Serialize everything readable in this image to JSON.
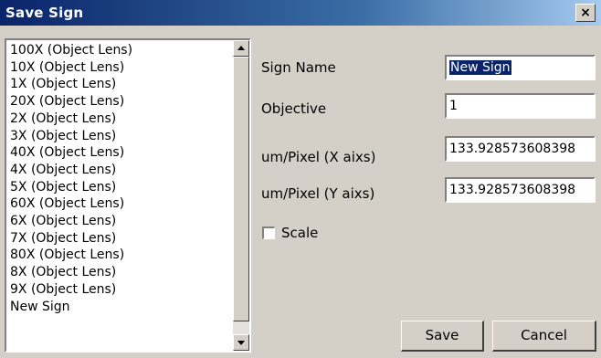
{
  "window": {
    "title": "Save Sign",
    "close_label": "×"
  },
  "list": {
    "items": [
      "100X (Object Lens)",
      "10X (Object Lens)",
      "1X (Object Lens)",
      "20X (Object Lens)",
      "2X (Object Lens)",
      "3X (Object Lens)",
      "40X (Object Lens)",
      "4X (Object Lens)",
      "5X (Object Lens)",
      "60X (Object Lens)",
      "6X (Object Lens)",
      "7X (Object Lens)",
      "80X (Object Lens)",
      "8X (Object Lens)",
      "9X (Object Lens)",
      "New Sign"
    ]
  },
  "form": {
    "sign_name_label": "Sign Name",
    "sign_name_value": "New Sign",
    "objective_label": "Objective",
    "objective_value": "1",
    "um_x_label": "um/Pixel (X aixs)",
    "um_x_value": "133.928573608398",
    "um_y_label": "um/Pixel (Y aixs)",
    "um_y_value": "133.928573608398",
    "scale_label": "Scale",
    "scale_checked": false
  },
  "buttons": {
    "save": "Save",
    "cancel": "Cancel"
  },
  "colors": {
    "title_bar": "#0a246a",
    "dialog_bg": "#d4d0c8",
    "selection": "#0a246a"
  }
}
